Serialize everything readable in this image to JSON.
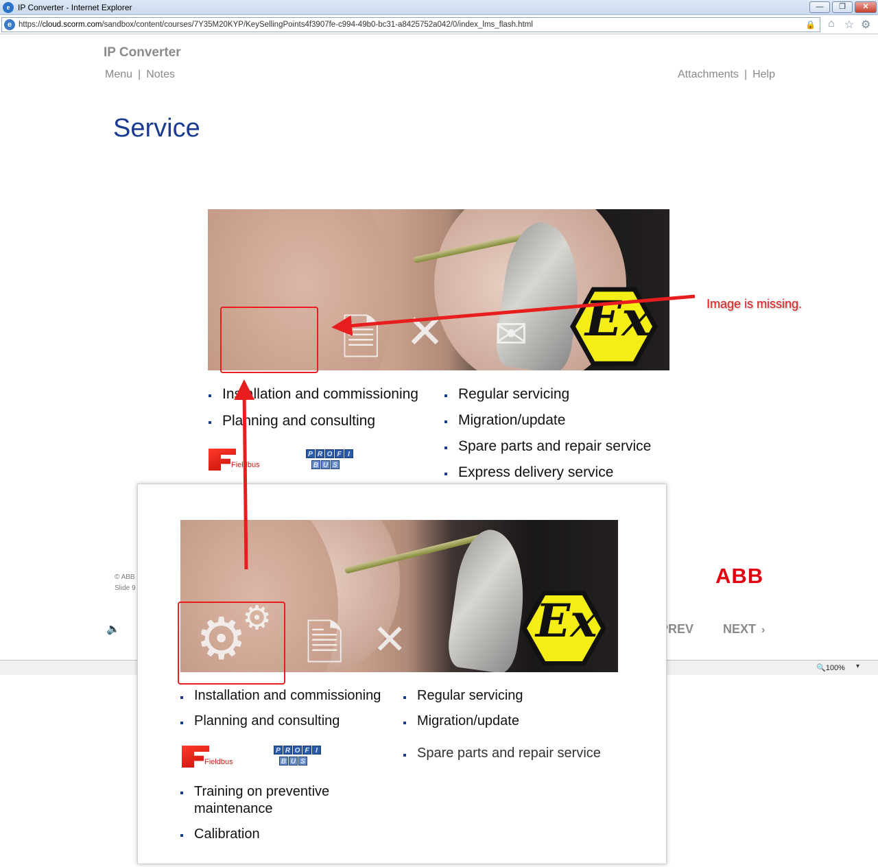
{
  "browser": {
    "window_title": "IP Converter - Internet Explorer",
    "url_prefix": "https://",
    "url_host": "cloud.scorm.com",
    "url_path": "/sandbox/content/courses/7Y35M20KYP/KeySellingPoints4f3907fe-c994-49b0-bc31-a8425752a042/0/index_lms_flash.html",
    "zoom": "100%",
    "buttons": {
      "minimize": "—",
      "maximize": "❐",
      "close": "✕"
    }
  },
  "course": {
    "title": "IP Converter",
    "nav_left": [
      "Menu",
      "Notes"
    ],
    "nav_right": [
      "Attachments",
      "Help"
    ]
  },
  "slide": {
    "title": "Service",
    "bullets_left": [
      "Installation and commissioning",
      "Planning and consulting"
    ],
    "bullets_right": [
      "Regular servicing",
      "Migration/update",
      "Spare parts and repair service",
      "Express delivery service"
    ],
    "ex_label": "Ex",
    "fieldbus_label": "Fieldbus",
    "profibus_top": [
      "P",
      "R",
      "O",
      "F",
      "I"
    ],
    "profibus_bottom": [
      "B",
      "U",
      "S"
    ],
    "copyright": "© ABB",
    "slide_number": "Slide 9",
    "abb_logo": "ABB",
    "prev_label": "PREV",
    "next_label": "NEXT"
  },
  "annotation": {
    "text": "Image is missing.",
    "color": "#e31a1a"
  },
  "overlay": {
    "bullets_left_top": [
      "Installation and commissioning",
      "Planning and consulting"
    ],
    "bullets_left_bottom": [
      "Training on preventive maintenance",
      "Calibration"
    ],
    "bullets_right": [
      "Regular servicing",
      "Migration/update",
      "Spare parts and repair service"
    ],
    "ex_label": "Ex",
    "fieldbus_label": "Fieldbus"
  }
}
